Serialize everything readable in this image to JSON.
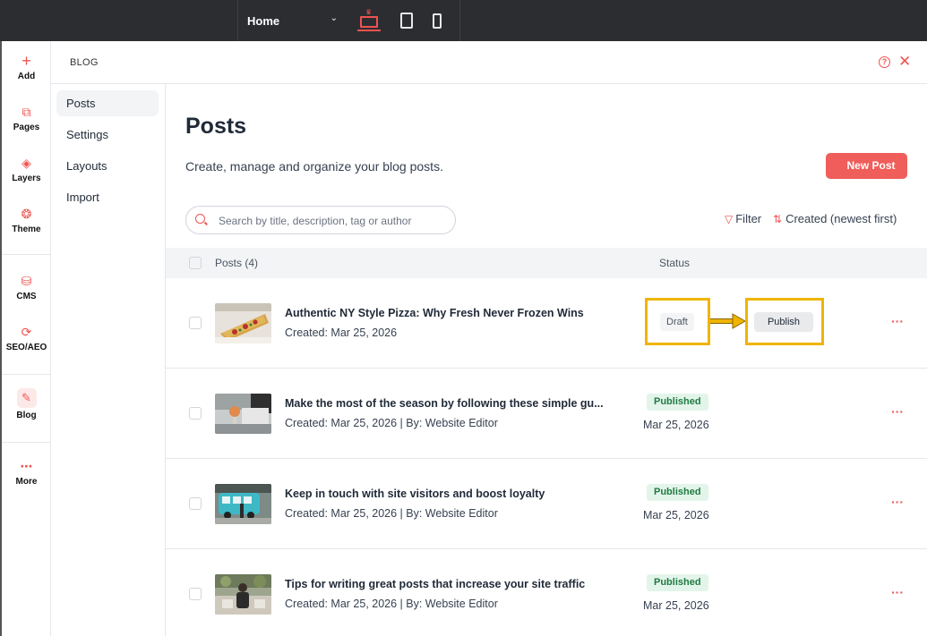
{
  "topbar": {
    "page_select": "Home",
    "chevron": "⌄",
    "devices": [
      "desktop-icon",
      "tablet-icon",
      "mobile-icon"
    ]
  },
  "rail": {
    "items": [
      {
        "label": "Add",
        "icon": "plus-icon",
        "glyph": "+"
      },
      {
        "label": "Pages",
        "icon": "pages-icon",
        "glyph": "⧉"
      },
      {
        "label": "Layers",
        "icon": "layers-icon",
        "glyph": "◈"
      },
      {
        "label": "Theme",
        "icon": "theme-icon",
        "glyph": "❂"
      },
      {
        "label": "CMS",
        "icon": "database-icon",
        "glyph": "⛁"
      },
      {
        "label": "SEO/AEO",
        "icon": "seo-icon",
        "glyph": "⟳"
      },
      {
        "label": "Blog",
        "icon": "blog-icon",
        "glyph": "✎"
      },
      {
        "label": "More",
        "icon": "more-icon",
        "glyph": "⋯"
      }
    ]
  },
  "panel": {
    "title": "BLOG",
    "help": "?",
    "close": "✕"
  },
  "subnav": {
    "items": [
      "Posts",
      "Settings",
      "Layouts",
      "Import"
    ]
  },
  "main": {
    "heading": "Posts",
    "subtitle": "Create, manage and organize your blog posts.",
    "new_post": "New Post",
    "search_placeholder": "Search by title, description, tag or author",
    "filter": "Filter",
    "sort": "Created (newest first)",
    "filter_glyph": "▽",
    "sort_glyph": "⇅",
    "table": {
      "col_posts": "Posts (4)",
      "col_status": "Status"
    },
    "more_glyph": "···",
    "posts": [
      {
        "title": "Authentic NY Style Pizza: Why Fresh Never Frozen Wins",
        "meta": "Created: Mar 25, 2026",
        "status": "Draft",
        "action": "Publish"
      },
      {
        "title": "Make the most of the season by following these simple gu...",
        "meta": "Created: Mar 25, 2026 | By: Website Editor",
        "status": "Published",
        "date": "Mar 25, 2026"
      },
      {
        "title": "Keep in touch with site visitors and boost loyalty",
        "meta": "Created: Mar 25, 2026 | By: Website Editor",
        "status": "Published",
        "date": "Mar 25, 2026"
      },
      {
        "title": "Tips for writing great posts that increase your site traffic",
        "meta": "Created: Mar 25, 2026 | By: Website Editor",
        "status": "Published",
        "date": "Mar 25, 2026"
      }
    ]
  },
  "colors": {
    "accent": "#ef5350",
    "highlight": "#f0b400",
    "published_bg": "#e3f5ea",
    "published_text": "#1f7a42"
  }
}
